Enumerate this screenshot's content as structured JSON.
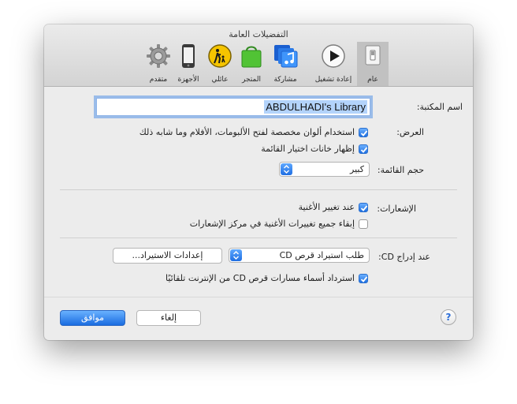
{
  "window": {
    "title": "التفضيلات العامة"
  },
  "toolbar": {
    "items": [
      {
        "label": "عام",
        "icon": "general-switch-icon",
        "selected": true
      },
      {
        "label": "إعادة تشغيل",
        "icon": "playback-icon"
      },
      {
        "label": "مشاركة",
        "icon": "sharing-icon"
      },
      {
        "label": "المتجر",
        "icon": "store-icon"
      },
      {
        "label": "عائلي",
        "icon": "parental-icon"
      },
      {
        "label": "الأجهزة",
        "icon": "devices-icon"
      },
      {
        "label": "متقدم",
        "icon": "advanced-gear-icon"
      }
    ]
  },
  "library": {
    "label": "اسم المكتبة:",
    "value": "ABDULHADI's Library"
  },
  "view": {
    "label": "العرض:",
    "use_custom_colors": {
      "label": "استخدام ألوان مخصصة لفتح الألبومات، الأفلام وما شابه ذلك",
      "checked": true
    },
    "show_list_checkboxes": {
      "label": "إظهار خانات اختيار القائمة",
      "checked": true
    }
  },
  "list_size": {
    "label": "حجم القائمة:",
    "value": "كبير"
  },
  "notifications": {
    "label": "الإشعارات:",
    "when_song_changes": {
      "label": "عند تغيير الأغنية",
      "checked": true
    },
    "keep_all": {
      "label": "إبقاء جميع تغييرات الأغنية في مركز الإشعارات",
      "checked": false
    }
  },
  "cd_insert": {
    "label": "عند إدراج CD:",
    "value": "طلب استيراد قرص CD",
    "import_settings_button": "إعدادات الاستيراد...",
    "retrieve_names": {
      "label": "استرداد أسماء مسارات قرص CD من الإنترنت تلقائيًا",
      "checked": true
    }
  },
  "buttons": {
    "ok": "موافق",
    "cancel": "إلغاء",
    "help": "?"
  },
  "colors": {
    "accent": "#1e6fe0",
    "selection": "#b3d3fb",
    "window_bg": "#ececec"
  }
}
